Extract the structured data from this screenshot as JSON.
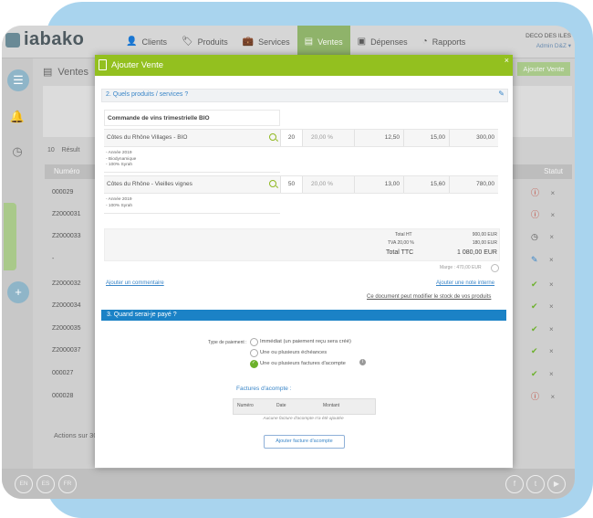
{
  "app": {
    "logo_text": "iabako",
    "nav": [
      {
        "label": "Clients",
        "icon": "user-icon"
      },
      {
        "label": "Produits",
        "icon": "tag-icon"
      },
      {
        "label": "Services",
        "icon": "briefcase-icon"
      },
      {
        "label": "Ventes",
        "icon": "document-icon",
        "active": true
      },
      {
        "label": "Dépenses",
        "icon": "wallet-icon"
      },
      {
        "label": "Rapports",
        "icon": "chart-icon"
      }
    ],
    "user": {
      "company": "DECO DES ILES",
      "name": "Admin D&Z"
    }
  },
  "background": {
    "page_title": "Ventes",
    "add_button": "Ajouter Vente",
    "page_size": "10",
    "results_label": "Résult",
    "table_headers": {
      "numero": "Numéro",
      "statut": "Statut"
    },
    "rows": [
      {
        "numero": "000029"
      },
      {
        "numero": "Z2000031"
      },
      {
        "numero": "Z2000033"
      },
      {
        "numero": "-"
      },
      {
        "numero": "Z2000032"
      },
      {
        "numero": "Z2000034"
      },
      {
        "numero": "Z2000035"
      },
      {
        "numero": "Z2000037"
      },
      {
        "numero": "000027"
      },
      {
        "numero": "000028"
      }
    ],
    "actions_label": "Actions sur 30",
    "languages": [
      "EN",
      "ES",
      "FR"
    ]
  },
  "modal": {
    "title": "Ajouter Vente",
    "close": "×",
    "section2_title": "2. Quels produits / services ?",
    "group_name": "Commande de vins trimestrielle BIO",
    "products": [
      {
        "name": "Côtes du Rhône Villages - BIO",
        "qty": "20",
        "discount": "20,00 %",
        "unit_price": "12,50",
        "price_ht": "15,00",
        "total": "300,00",
        "desc": [
          "- Année 2019",
          "- Biodynamique",
          "- 100% Syrah"
        ]
      },
      {
        "name": "Côtes du Rhône - Vieilles vignes",
        "qty": "50",
        "discount": "20,00 %",
        "unit_price": "13,00",
        "price_ht": "15,60",
        "total": "780,00",
        "desc": [
          "- Année 2019",
          "- 100% Syrah"
        ]
      }
    ],
    "totals": {
      "ht_label": "Total HT",
      "ht_value": "900,00 EUR",
      "tva_label": "TVA 20,00 %",
      "tva_value": "180,00 EUR",
      "ttc_label": "Total TTC",
      "ttc_value": "1 080,00 EUR"
    },
    "margin": "Marge : 470,00 EUR",
    "add_comment": "Ajouter un commentaire",
    "add_note": "Ajouter une note interne",
    "stock_note": "Ce document peut modifier le stock de vos produits",
    "section3_title": "3. Quand serai-je payé ?",
    "payment_type_label": "Type de paiement :",
    "payment_options": [
      {
        "label": "Immédiat (un paiement reçu sera créé)",
        "selected": false
      },
      {
        "label": "Une ou plusieurs échéances",
        "selected": false
      },
      {
        "label": "Une ou plusieurs factures d'acompte",
        "selected": true
      }
    ],
    "acompte_title": "Factures d'acompte :",
    "acompte_headers": [
      "Numéro",
      "Date",
      "Montant"
    ],
    "acompte_empty": "Aucune facture d'acompte n'a été ajoutée",
    "acompte_button": "Ajouter facture d'acompte"
  }
}
